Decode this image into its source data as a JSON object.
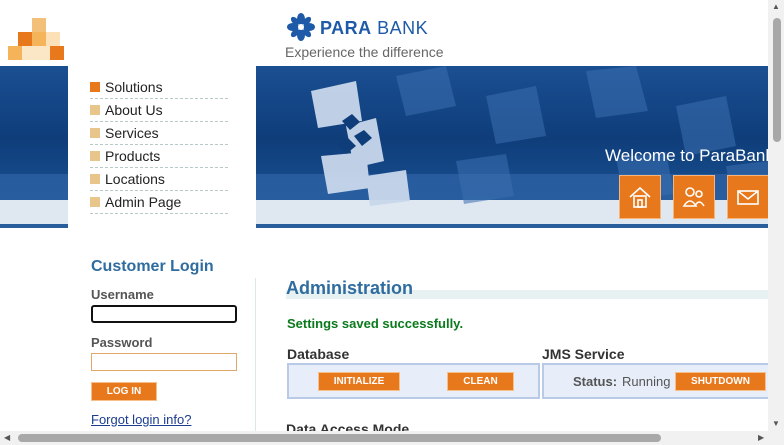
{
  "header": {
    "brand_bold": "PARA",
    "brand_rest": " BANK",
    "tagline": "Experience the difference",
    "welcome": "Welcome to ParaBank"
  },
  "left_menu": {
    "items": [
      "Solutions",
      "About Us",
      "Services",
      "Products",
      "Locations",
      "Admin Page"
    ]
  },
  "header_buttons": [
    {
      "icon": "home-icon"
    },
    {
      "icon": "about-icon"
    },
    {
      "icon": "contact-icon"
    }
  ],
  "login": {
    "title": "Customer Login",
    "username_label": "Username",
    "password_label": "Password",
    "button": "LOG IN",
    "forgot": "Forgot login info?"
  },
  "main": {
    "title": "Administration",
    "success": "Settings saved successfully.",
    "database": {
      "title": "Database",
      "initialize": "INITIALIZE",
      "clean": "CLEAN"
    },
    "jms": {
      "title": "JMS Service",
      "status_label": "Status:",
      "status_value": "Running",
      "shutdown": "SHUTDOWN"
    },
    "data_access_title": "Data Access Mode"
  },
  "colors": {
    "accent": "#e8781c",
    "brand_blue": "#1e5aa8",
    "band_blue": "#0f3d7a",
    "success_green": "#0a7a1c"
  }
}
